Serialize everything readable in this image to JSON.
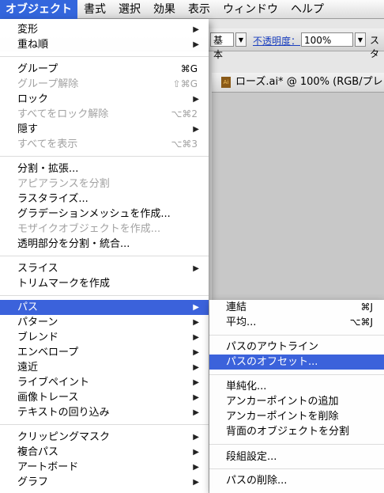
{
  "menubar": {
    "items": [
      {
        "label": "オブジェクト",
        "active": true
      },
      {
        "label": "書式"
      },
      {
        "label": "選択"
      },
      {
        "label": "効果"
      },
      {
        "label": "表示"
      },
      {
        "label": "ウィンドウ"
      },
      {
        "label": "ヘルプ"
      }
    ]
  },
  "controlbar": {
    "style_value": "基本",
    "opacity_label": "不透明度：",
    "opacity_value": "100%",
    "style_label_partial": "スタ"
  },
  "document_tab": {
    "title": "ローズ.ai* @ 100% (RGB/プレビ",
    "icon_label": "Ai"
  },
  "object_menu": {
    "items": [
      {
        "label": "変形",
        "submenu": true
      },
      {
        "label": "重ね順",
        "submenu": true
      },
      {
        "label": "グループ",
        "shortcut": "⌘G"
      },
      {
        "label": "グループ解除",
        "shortcut": "⇧⌘G",
        "disabled": true
      },
      {
        "label": "ロック",
        "submenu": true
      },
      {
        "label": "すべてをロック解除",
        "shortcut": "⌥⌘2",
        "disabled": true
      },
      {
        "label": "隠す",
        "submenu": true
      },
      {
        "label": "すべてを表示",
        "shortcut": "⌥⌘3",
        "disabled": true
      },
      {
        "label": "分割・拡張..."
      },
      {
        "label": "アピアランスを分割",
        "disabled": true
      },
      {
        "label": "ラスタライズ..."
      },
      {
        "label": "グラデーションメッシュを作成..."
      },
      {
        "label": "モザイクオブジェクトを作成...",
        "disabled": true
      },
      {
        "label": "透明部分を分割・統合..."
      },
      {
        "label": "スライス",
        "submenu": true
      },
      {
        "label": "トリムマークを作成"
      },
      {
        "label": "パス",
        "submenu": true,
        "highlighted": true
      },
      {
        "label": "パターン",
        "submenu": true
      },
      {
        "label": "ブレンド",
        "submenu": true
      },
      {
        "label": "エンベロープ",
        "submenu": true
      },
      {
        "label": "遠近",
        "submenu": true
      },
      {
        "label": "ライブペイント",
        "submenu": true
      },
      {
        "label": "画像トレース",
        "submenu": true
      },
      {
        "label": "テキストの回り込み",
        "submenu": true
      },
      {
        "label": "クリッピングマスク",
        "submenu": true
      },
      {
        "label": "複合パス",
        "submenu": true
      },
      {
        "label": "アートボード",
        "submenu": true
      },
      {
        "label": "グラフ",
        "submenu": true
      }
    ]
  },
  "path_submenu": {
    "items": [
      {
        "label": "連結",
        "shortcut": "⌘J"
      },
      {
        "label": "平均...",
        "shortcut": "⌥⌘J"
      },
      {
        "label": "パスのアウトライン"
      },
      {
        "label": "パスのオフセット...",
        "highlighted": true
      },
      {
        "label": "単純化..."
      },
      {
        "label": "アンカーポイントの追加"
      },
      {
        "label": "アンカーポイントを削除"
      },
      {
        "label": "背面のオブジェクトを分割"
      },
      {
        "label": "段組設定..."
      },
      {
        "label": "パスの削除..."
      }
    ]
  },
  "colors": {
    "menubar_highlight": "#3366dd",
    "item_highlight": "#3b62db",
    "disabled_text": "#a2a2a2"
  }
}
